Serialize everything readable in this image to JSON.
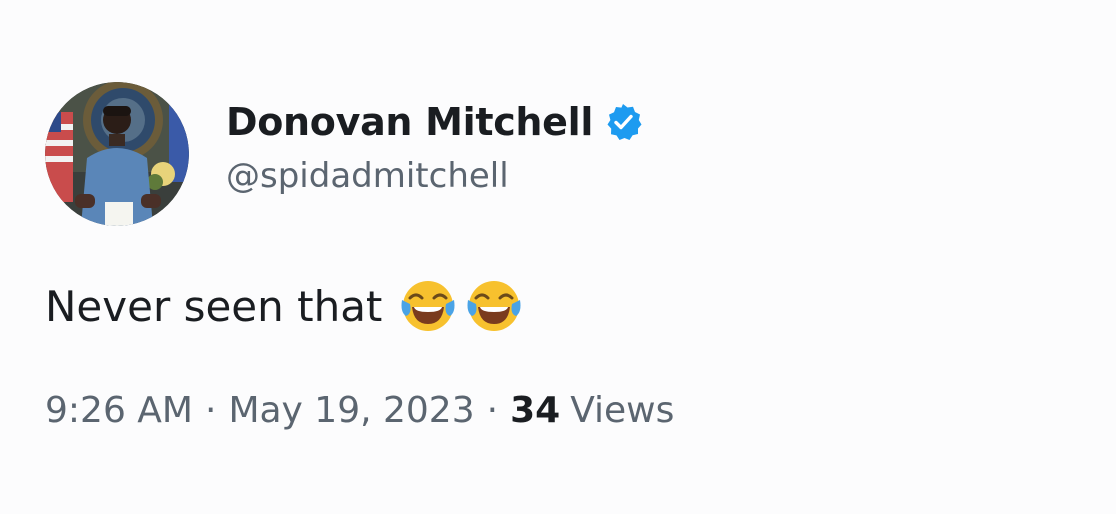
{
  "user": {
    "display_name": "Donovan Mitchell",
    "handle": "@spidadmitchell",
    "verified": true,
    "avatar_icon": "profile-photo",
    "verified_color": "#1d9bf0"
  },
  "tweet": {
    "text": "Never seen that",
    "emojis": [
      "face-with-tears-of-joy-icon",
      "face-with-tears-of-joy-icon"
    ]
  },
  "meta": {
    "time": "9:26 AM",
    "separator": "·",
    "date": "May 19, 2023",
    "views_count": "34",
    "views_label": "Views"
  }
}
